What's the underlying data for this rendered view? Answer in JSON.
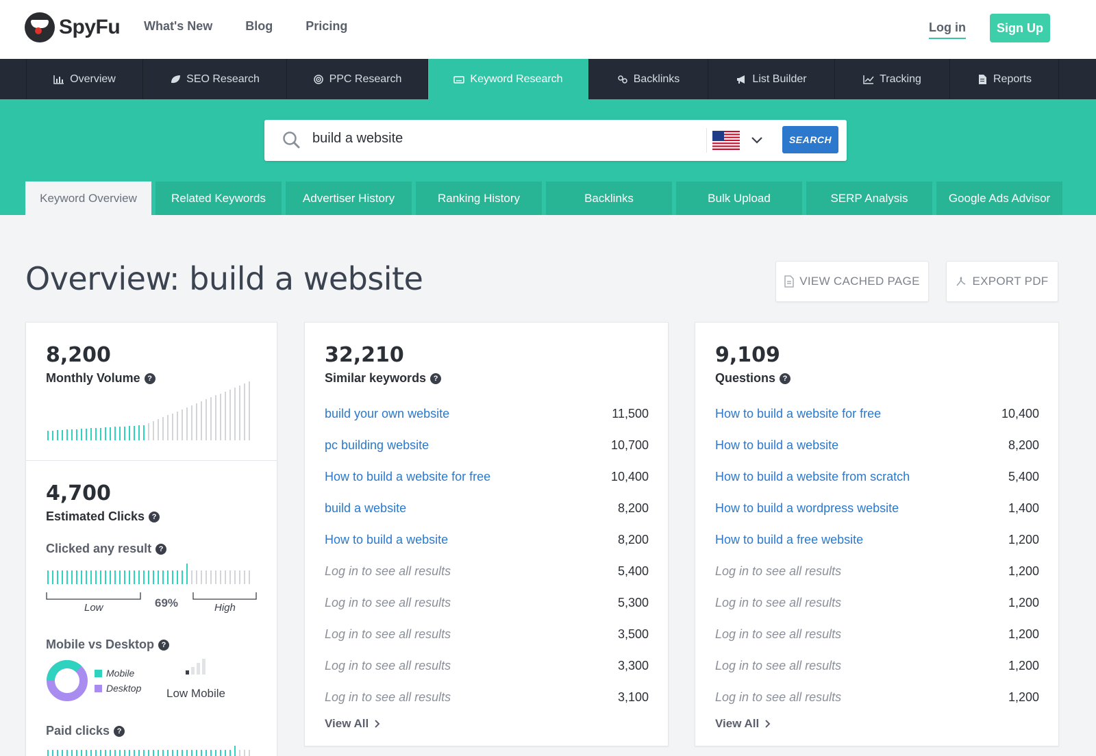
{
  "header": {
    "logo_text": "SpyFu",
    "nav": [
      "What's New",
      "Blog",
      "Pricing"
    ],
    "login": "Log in",
    "signup": "Sign Up"
  },
  "mainnav": [
    {
      "label": "Overview",
      "icon": "bar-chart-icon"
    },
    {
      "label": "SEO Research",
      "icon": "leaf-icon"
    },
    {
      "label": "PPC Research",
      "icon": "target-icon"
    },
    {
      "label": "Keyword Research",
      "icon": "keyboard-icon",
      "active": true
    },
    {
      "label": "Backlinks",
      "icon": "link-icon"
    },
    {
      "label": "List Builder",
      "icon": "megaphone-icon"
    },
    {
      "label": "Tracking",
      "icon": "line-chart-icon"
    },
    {
      "label": "Reports",
      "icon": "document-icon"
    }
  ],
  "search": {
    "value": "build a website",
    "button": "SEARCH",
    "country": "us-flag-icon"
  },
  "subtabs": [
    "Keyword Overview",
    "Related Keywords",
    "Advertiser History",
    "Ranking History",
    "Backlinks",
    "Bulk Upload",
    "SERP Analysis",
    "Google Ads Advisor"
  ],
  "title": "Overview: build a website",
  "buttons": {
    "cached": "VIEW CACHED PAGE",
    "export": "EXPORT PDF"
  },
  "volume_card": {
    "monthly_volume": "8,200",
    "monthly_volume_label": "Monthly Volume",
    "clicks": "4,700",
    "clicks_label": "Estimated Clicks",
    "clicked_any_label": "Clicked any result",
    "clicked_pct": "69%",
    "clicked_fraction": 0.69,
    "low": "Low",
    "high": "High",
    "mobile_label": "Mobile vs Desktop",
    "legend_mobile": "Mobile",
    "legend_desktop": "Desktop",
    "mobile_level": "Low Mobile",
    "paid_label": "Paid clicks"
  },
  "similar_card": {
    "count": "32,210",
    "label": "Similar keywords",
    "rows": [
      {
        "kw": "build your own website",
        "vol": "11,500",
        "locked": false
      },
      {
        "kw": "pc building website",
        "vol": "10,700",
        "locked": false
      },
      {
        "kw": "How to build a website for free",
        "vol": "10,400",
        "locked": false
      },
      {
        "kw": "build a website",
        "vol": "8,200",
        "locked": false
      },
      {
        "kw": "How to build a website",
        "vol": "8,200",
        "locked": false
      },
      {
        "kw": "Log in to see all results",
        "vol": "5,400",
        "locked": true
      },
      {
        "kw": "Log in to see all results",
        "vol": "5,300",
        "locked": true
      },
      {
        "kw": "Log in to see all results",
        "vol": "3,500",
        "locked": true
      },
      {
        "kw": "Log in to see all results",
        "vol": "3,300",
        "locked": true
      },
      {
        "kw": "Log in to see all results",
        "vol": "3,100",
        "locked": true
      }
    ],
    "view_all": "View All"
  },
  "questions_card": {
    "count": "9,109",
    "label": "Questions",
    "rows": [
      {
        "kw": "How to build a website for free",
        "vol": "10,400",
        "locked": false
      },
      {
        "kw": "How to build a website",
        "vol": "8,200",
        "locked": false
      },
      {
        "kw": "How to build a website from scratch",
        "vol": "5,400",
        "locked": false
      },
      {
        "kw": "How to build a wordpress website",
        "vol": "1,400",
        "locked": false
      },
      {
        "kw": "How to build a free website",
        "vol": "1,200",
        "locked": false
      },
      {
        "kw": "Log in to see all results",
        "vol": "1,200",
        "locked": true
      },
      {
        "kw": "Log in to see all results",
        "vol": "1,200",
        "locked": true
      },
      {
        "kw": "Log in to see all results",
        "vol": "1,200",
        "locked": true
      },
      {
        "kw": "Log in to see all results",
        "vol": "1,200",
        "locked": true
      },
      {
        "kw": "Log in to see all results",
        "vol": "1,200",
        "locked": true
      }
    ],
    "view_all": "View All"
  },
  "colors": {
    "accent": "#2fc4a5",
    "nav_bg": "#252b36",
    "link": "#2b78cc",
    "mobile": "#2fd1bf",
    "desktop": "#a98cf0"
  }
}
